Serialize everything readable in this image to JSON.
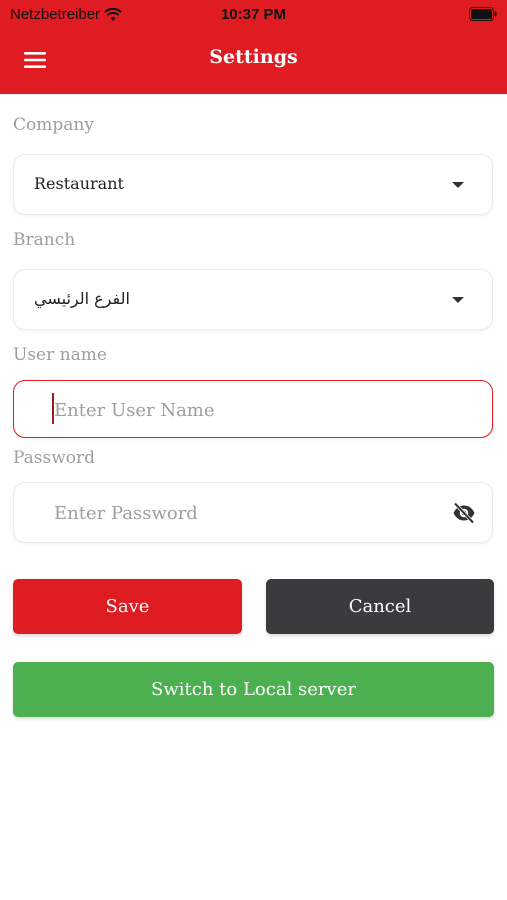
{
  "status": {
    "carrier": "Netzbetreiber",
    "time": "10:37 PM"
  },
  "header": {
    "title": "Settings"
  },
  "form": {
    "company": {
      "label": "Company",
      "value": "Restaurant"
    },
    "branch": {
      "label": "Branch",
      "value": "الفرع الرئيسي"
    },
    "username": {
      "label": "User name",
      "placeholder": "Enter User Name",
      "value": ""
    },
    "password": {
      "label": "Password",
      "placeholder": "Enter Password",
      "value": ""
    }
  },
  "buttons": {
    "save": "Save",
    "cancel": "Cancel",
    "switch": "Switch to Local server"
  },
  "colors": {
    "primary": "#e01c23",
    "cancel": "#3b3b3d",
    "switch": "#4caf50"
  },
  "icons": [
    "wifi-icon",
    "battery-icon",
    "menu-icon",
    "chevron-down-icon",
    "eye-off-icon"
  ]
}
